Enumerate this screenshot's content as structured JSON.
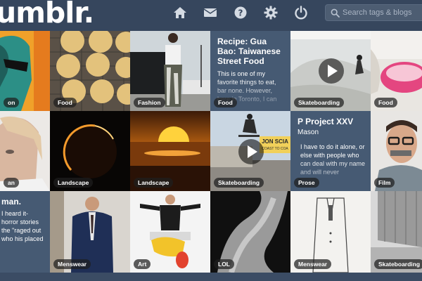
{
  "header": {
    "logo": "umblr.",
    "search": {
      "placeholder": "Search tags & blogs"
    },
    "icons": [
      "home-icon",
      "mail-icon",
      "help-icon",
      "gear-icon",
      "power-icon",
      "search-icon"
    ]
  },
  "tiles": {
    "r1c1": {
      "tag": "on"
    },
    "r1c2": {
      "tag": "Food"
    },
    "r1c3": {
      "tag": "Fashion"
    },
    "r1c4": {
      "tag": "Food",
      "title": "Recipe: Gua Bao: Taiwanese Street Food",
      "body": "This is one of my favorite things to eat, bar none. However, here in Toronto, I can"
    },
    "r1c5": {
      "tag": "Skateboarding"
    },
    "r1c6": {
      "tag": "Food"
    },
    "r2c1": {
      "tag": "an"
    },
    "r2c2": {
      "tag": "Landscape"
    },
    "r2c3": {
      "tag": "Landscape"
    },
    "r2c4": {
      "tag": "Skateboarding",
      "sign_line1": "JON SCIA",
      "sign_line2": "COAST TO COA"
    },
    "r2c5": {
      "tag": "Prose",
      "title": "P Project XXV",
      "subtitle": "Mason",
      "body": "I have to do it alone, or else with people who can deal with my name and will never"
    },
    "r2c6": {
      "tag": "Film"
    },
    "r3c1": {
      "title": "man.",
      "body": "I heard it- horror stories the \"raged out who his placed"
    },
    "r3c2": {
      "tag": "Menswear"
    },
    "r3c3": {
      "tag": "Art"
    },
    "r3c4": {
      "tag": "LOL"
    },
    "r3c5": {
      "tag": "Menswear"
    },
    "r3c6": {
      "tag": "Skateboarding"
    }
  },
  "colors": {
    "dashboard": "#36465d",
    "text_post": "#465a73",
    "tag_bg": "#1e1e1e"
  }
}
